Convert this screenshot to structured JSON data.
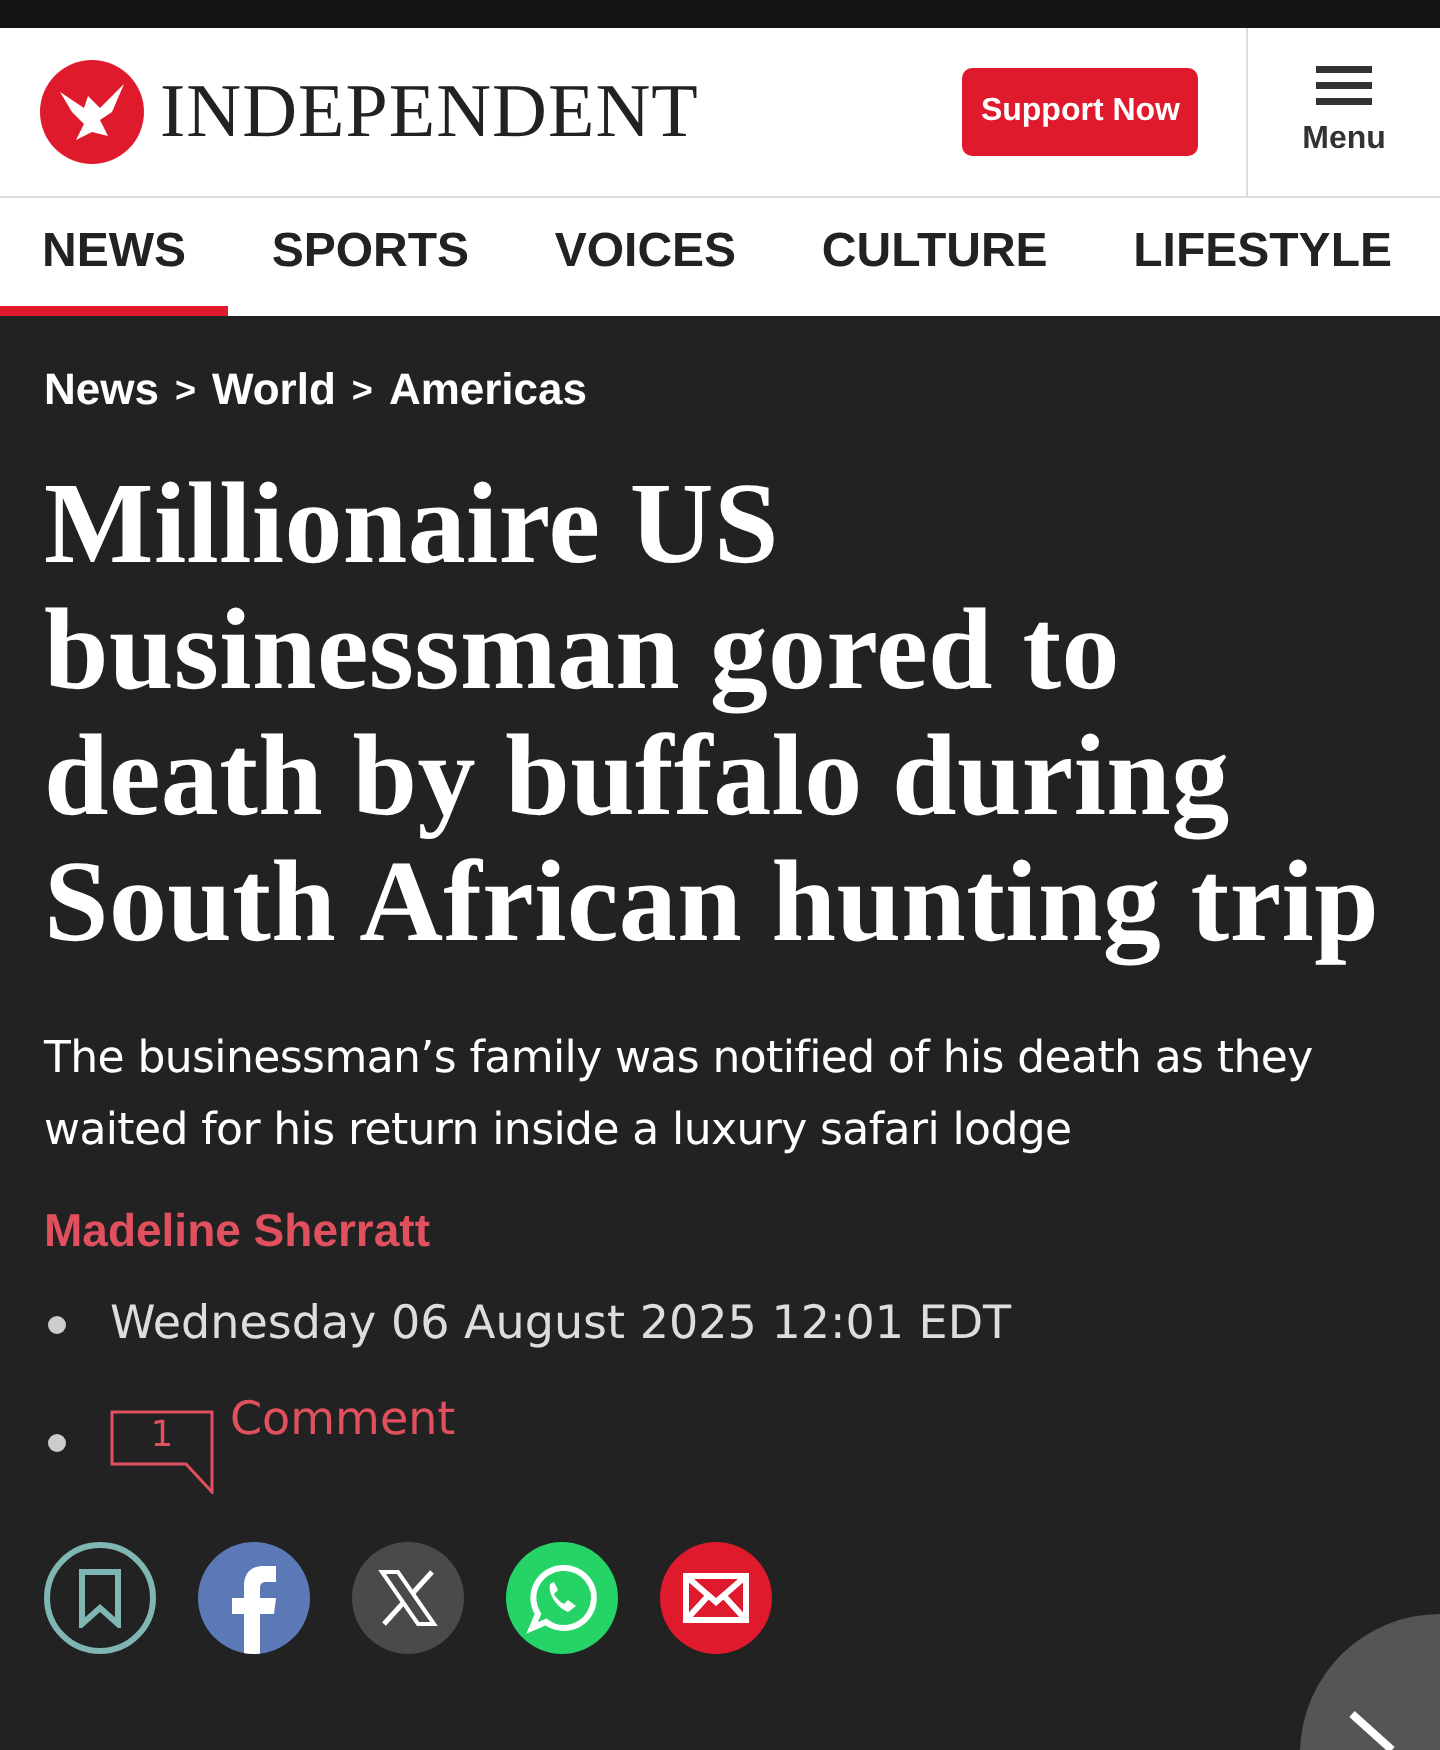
{
  "header": {
    "logo": "INDEPENDENT",
    "support_button": "Support Now",
    "menu_label": "Menu"
  },
  "nav_tabs": [
    {
      "label": "NEWS",
      "selected": true
    },
    {
      "label": "SPORTS",
      "selected": false
    },
    {
      "label": "VOICES",
      "selected": false
    },
    {
      "label": "CULTURE",
      "selected": false
    },
    {
      "label": "LIFESTYLE",
      "selected": false
    }
  ],
  "breadcrumb": [
    {
      "label": "News"
    },
    {
      "label": "World"
    },
    {
      "label": "Americas"
    }
  ],
  "breadcrumb_separator": ">",
  "headline": "Millionaire US businessman gored to death by buffalo during South African hunting trip",
  "standfirst": "The businessman’s family was notified of his death as they waited for his return inside a luxury safari lodge",
  "author": "Madeline Sherratt",
  "date": "Wednesday 06 August 2025 12:01 EDT",
  "comments": {
    "count": "1",
    "label": "Comment"
  },
  "share_buttons": [
    {
      "kind": "bookmark"
    },
    {
      "kind": "facebook"
    },
    {
      "kind": "x"
    },
    {
      "kind": "whatsapp"
    },
    {
      "kind": "email"
    }
  ]
}
